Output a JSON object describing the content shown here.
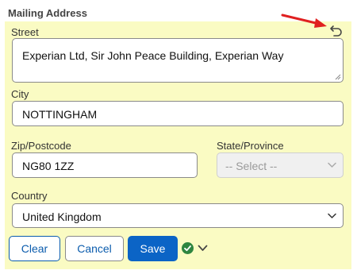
{
  "section": {
    "title": "Mailing Address"
  },
  "fields": {
    "street": {
      "label": "Street",
      "value": "Experian Ltd, Sir John Peace Building, Experian Way"
    },
    "city": {
      "label": "City",
      "value": "NOTTINGHAM"
    },
    "zip": {
      "label": "Zip/Postcode",
      "value": "NG80 1ZZ"
    },
    "state": {
      "label": "State/Province",
      "value": "-- Select --"
    },
    "country": {
      "label": "Country",
      "value": "United Kingdom"
    }
  },
  "buttons": {
    "clear": "Clear",
    "cancel": "Cancel",
    "save": "Save"
  },
  "icons": {
    "undo": "undo-icon",
    "status": "check-circle-icon",
    "menu": "chevron-down-icon",
    "pointer": "red-arrow"
  },
  "colors": {
    "panel": "#fafbc3",
    "accent": "#0b64c6",
    "success": "#2e8540",
    "arrow": "#e02020"
  }
}
